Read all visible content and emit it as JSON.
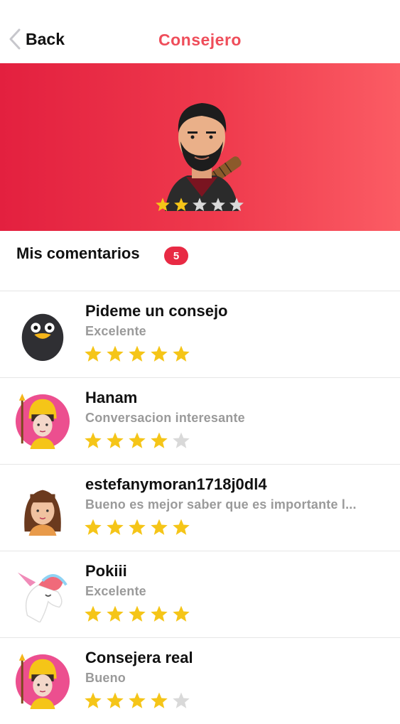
{
  "nav": {
    "back_label": "Back",
    "title": "Consejero"
  },
  "hero": {
    "rating": 2,
    "max_rating": 5
  },
  "section": {
    "title": "Mis comentarios",
    "count": "5"
  },
  "colors": {
    "accent": "#ef4d5a",
    "star_on": "#f5c518",
    "star_off": "#d9d9d9"
  },
  "comments": [
    {
      "name": "Pideme un consejo",
      "comment": "Excelente",
      "rating": 5,
      "avatar": "penguin-avatar"
    },
    {
      "name": "Hanam",
      "comment": "Conversacion interesante",
      "rating": 4,
      "avatar": "warrior-girl-avatar"
    },
    {
      "name": "estefanymoran1718j0dl4",
      "comment": "Bueno es mejor saber que es importante l...",
      "rating": 5,
      "avatar": "girl-avatar"
    },
    {
      "name": "Pokiii",
      "comment": "Excelente",
      "rating": 5,
      "avatar": "unicorn-avatar"
    },
    {
      "name": "Consejera real",
      "comment": "Bueno",
      "rating": 4,
      "avatar": "warrior-girl-avatar"
    }
  ]
}
